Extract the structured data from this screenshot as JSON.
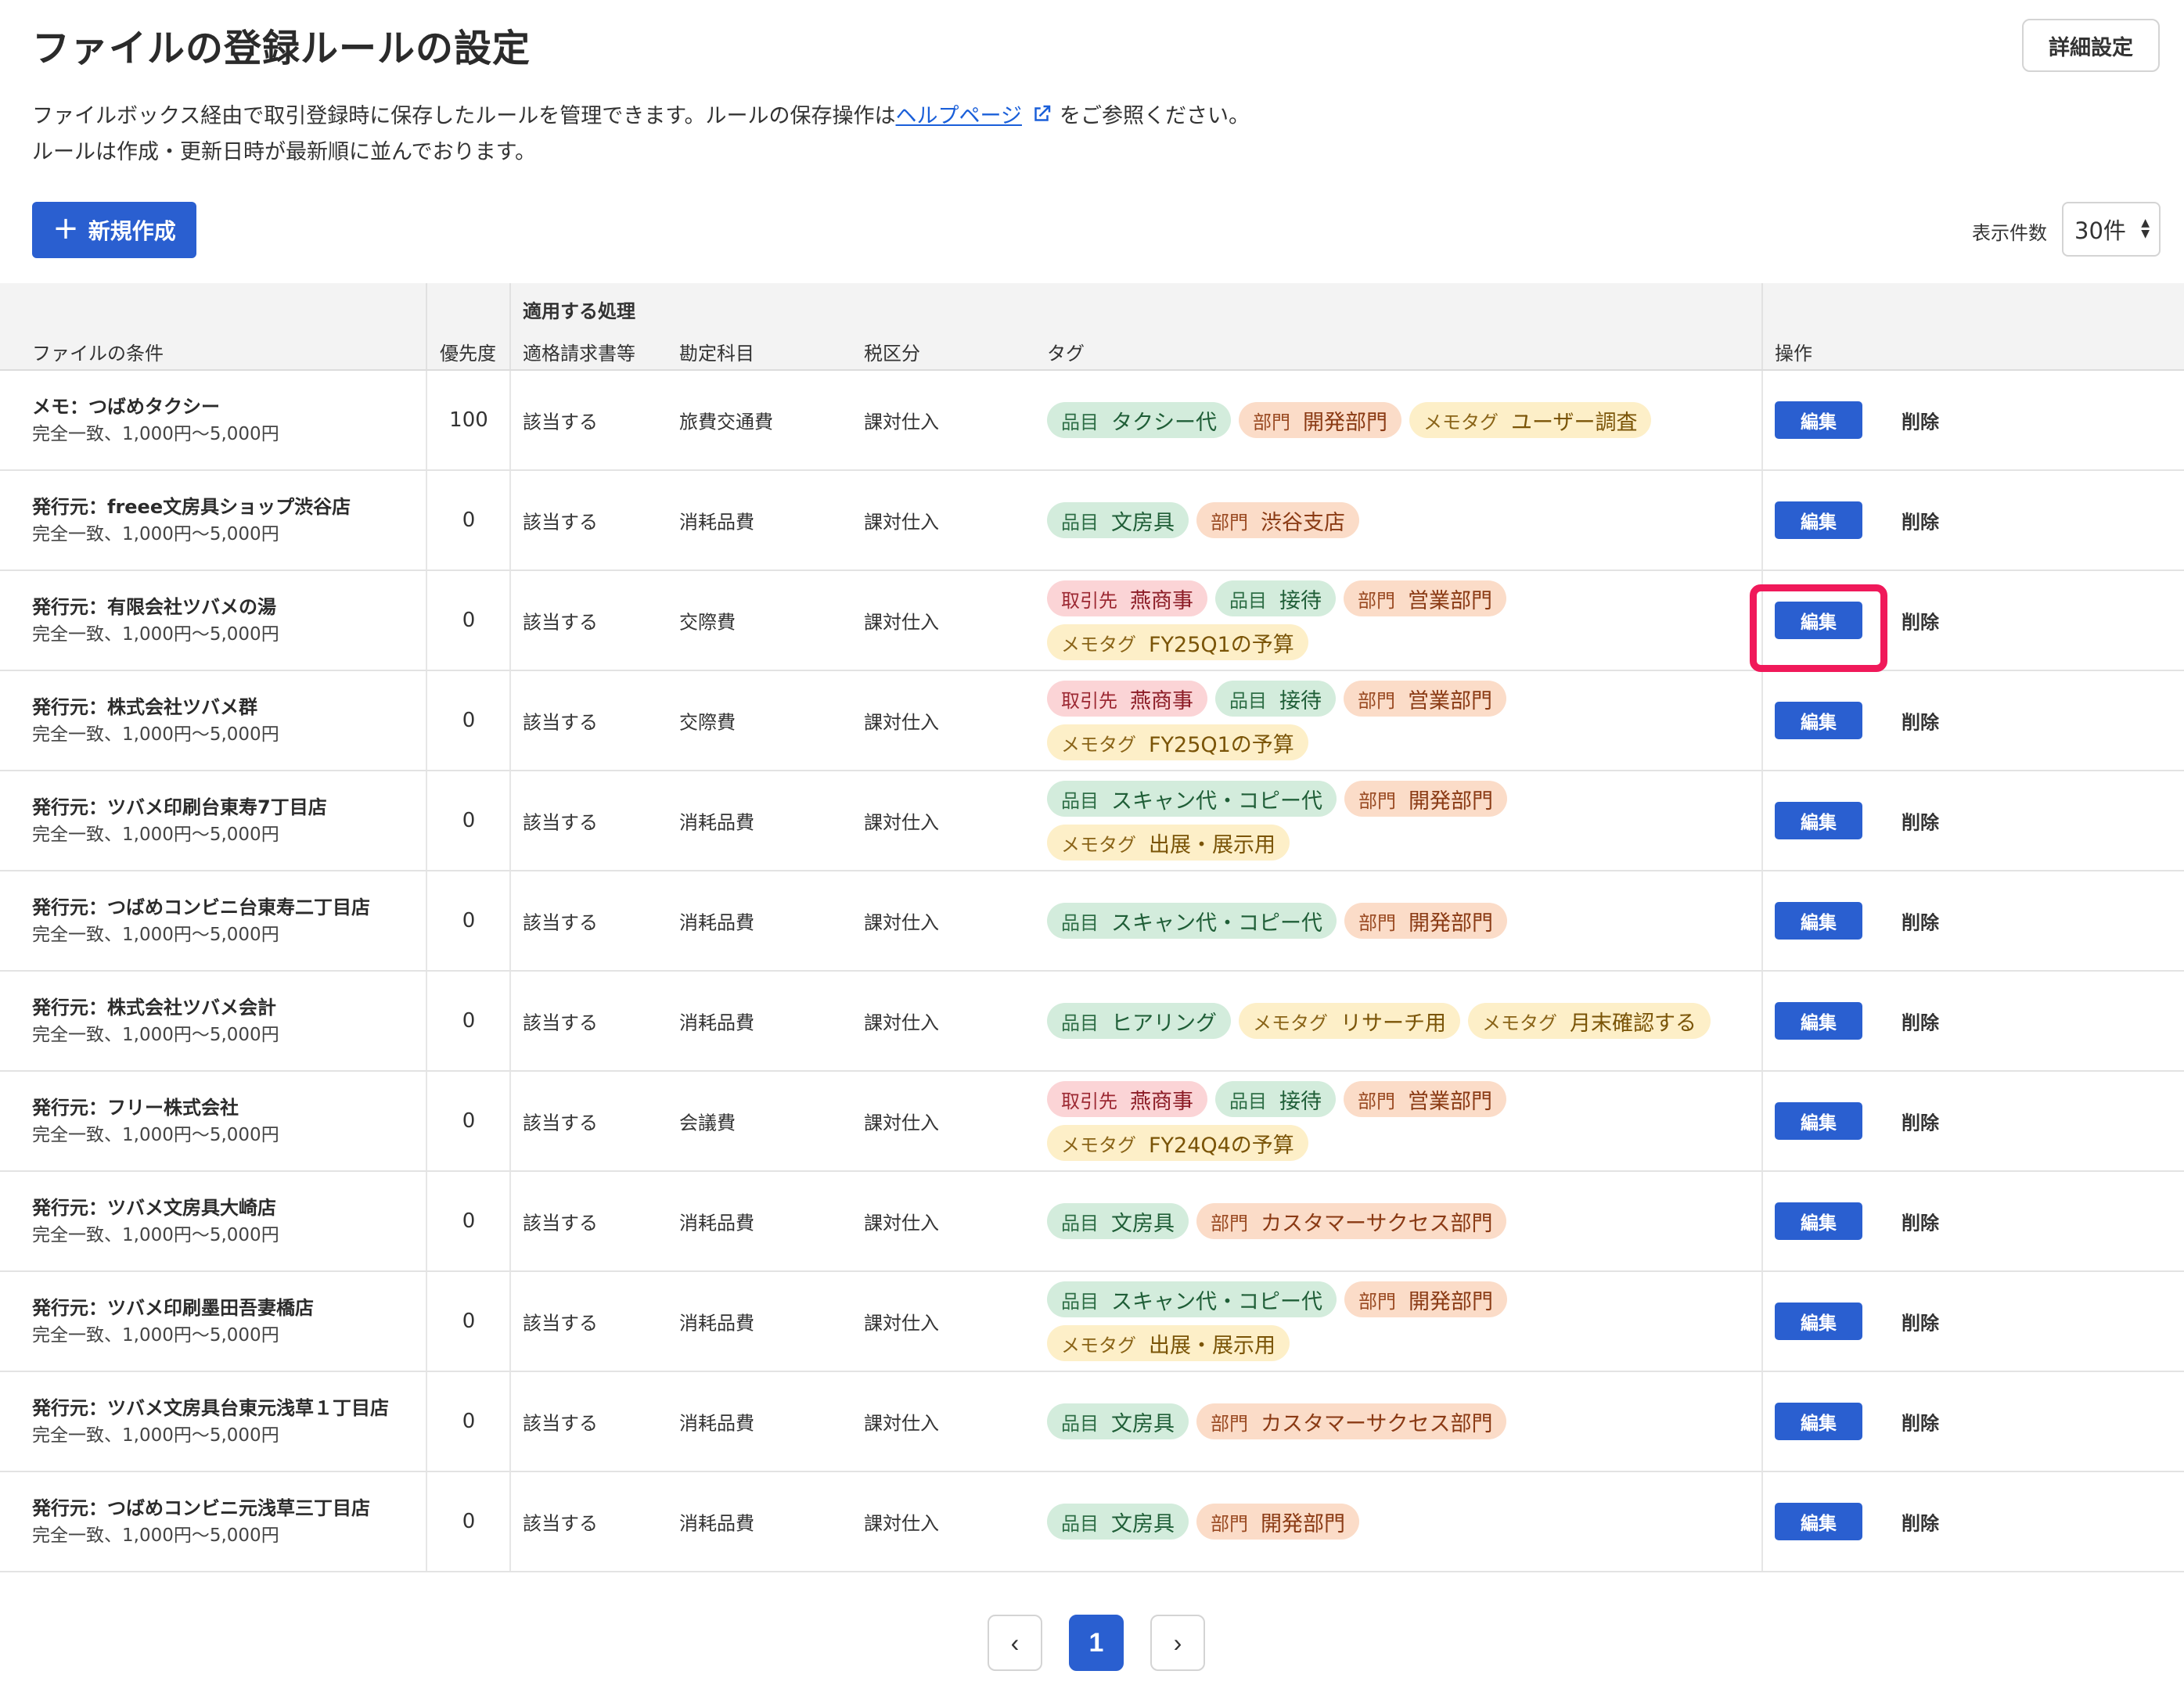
{
  "header": {
    "title": "ファイルの登録ルールの設定",
    "detail_button": "詳細設定",
    "description_line1_prefix": "ファイルボックス経由で取引登録時に保存したルールを管理できます。ルールの保存操作は",
    "description_link": "ヘルプページ",
    "description_line1_suffix": "をご参照ください。",
    "description_line2": "ルールは作成・更新日時が最新順に並んでおります。"
  },
  "toolbar": {
    "create_button": "新規作成",
    "per_page_label": "表示件数",
    "per_page_value": "30件"
  },
  "table": {
    "group_header": "適用する処理",
    "columns": {
      "condition": "ファイルの条件",
      "priority": "優先度",
      "invoice": "適格請求書等",
      "account": "勘定科目",
      "tax": "税区分",
      "tags": "タグ",
      "actions": "操作"
    },
    "edit_label": "編集",
    "delete_label": "削除",
    "rows": [
      {
        "title": "メモ：つばめタクシー",
        "sub": "完全一致、1,000円〜5,000円",
        "priority": "100",
        "invoice": "該当する",
        "account": "旅費交通費",
        "tax": "課対仕入",
        "tags": [
          {
            "kind": "item",
            "k": "品目",
            "v": "タクシー代"
          },
          {
            "kind": "dept",
            "k": "部門",
            "v": "開発部門"
          },
          {
            "kind": "memo",
            "k": "メモタグ",
            "v": "ユーザー調査"
          }
        ]
      },
      {
        "title": "発行元：freee文房具ショップ渋谷店",
        "sub": "完全一致、1,000円〜5,000円",
        "priority": "0",
        "invoice": "該当する",
        "account": "消耗品費",
        "tax": "課対仕入",
        "tags": [
          {
            "kind": "item",
            "k": "品目",
            "v": "文房具"
          },
          {
            "kind": "dept",
            "k": "部門",
            "v": "渋谷支店"
          }
        ]
      },
      {
        "title": "発行元：有限会社ツバメの湯",
        "sub": "完全一致、1,000円〜5,000円",
        "priority": "0",
        "invoice": "該当する",
        "account": "交際費",
        "tax": "課対仕入",
        "tags": [
          {
            "kind": "partner",
            "k": "取引先",
            "v": "燕商事"
          },
          {
            "kind": "item",
            "k": "品目",
            "v": "接待"
          },
          {
            "kind": "dept",
            "k": "部門",
            "v": "営業部門"
          },
          {
            "kind": "memo",
            "k": "メモタグ",
            "v": "FY25Q1の予算"
          }
        ]
      },
      {
        "title": "発行元：株式会社ツバメ群",
        "sub": "完全一致、1,000円〜5,000円",
        "priority": "0",
        "invoice": "該当する",
        "account": "交際費",
        "tax": "課対仕入",
        "tags": [
          {
            "kind": "partner",
            "k": "取引先",
            "v": "燕商事"
          },
          {
            "kind": "item",
            "k": "品目",
            "v": "接待"
          },
          {
            "kind": "dept",
            "k": "部門",
            "v": "営業部門"
          },
          {
            "kind": "memo",
            "k": "メモタグ",
            "v": "FY25Q1の予算"
          }
        ]
      },
      {
        "title": "発行元：ツバメ印刷台東寿7丁目店",
        "sub": "完全一致、1,000円〜5,000円",
        "priority": "0",
        "invoice": "該当する",
        "account": "消耗品費",
        "tax": "課対仕入",
        "tags": [
          {
            "kind": "item",
            "k": "品目",
            "v": "スキャン代・コピー代"
          },
          {
            "kind": "dept",
            "k": "部門",
            "v": "開発部門"
          },
          {
            "kind": "memo",
            "k": "メモタグ",
            "v": "出展・展示用"
          }
        ]
      },
      {
        "title": "発行元：つばめコンビニ台東寿二丁目店",
        "sub": "完全一致、1,000円〜5,000円",
        "priority": "0",
        "invoice": "該当する",
        "account": "消耗品費",
        "tax": "課対仕入",
        "tags": [
          {
            "kind": "item",
            "k": "品目",
            "v": "スキャン代・コピー代"
          },
          {
            "kind": "dept",
            "k": "部門",
            "v": "開発部門"
          }
        ]
      },
      {
        "title": "発行元：株式会社ツバメ会計",
        "sub": "完全一致、1,000円〜5,000円",
        "priority": "0",
        "invoice": "該当する",
        "account": "消耗品費",
        "tax": "課対仕入",
        "tags": [
          {
            "kind": "item",
            "k": "品目",
            "v": "ヒアリング"
          },
          {
            "kind": "memo",
            "k": "メモタグ",
            "v": "リサーチ用"
          },
          {
            "kind": "memo",
            "k": "メモタグ",
            "v": "月末確認する"
          }
        ]
      },
      {
        "title": "発行元：フリー株式会社",
        "sub": "完全一致、1,000円〜5,000円",
        "priority": "0",
        "invoice": "該当する",
        "account": "会議費",
        "tax": "課対仕入",
        "tags": [
          {
            "kind": "partner",
            "k": "取引先",
            "v": "燕商事"
          },
          {
            "kind": "item",
            "k": "品目",
            "v": "接待"
          },
          {
            "kind": "dept",
            "k": "部門",
            "v": "営業部門"
          },
          {
            "kind": "memo",
            "k": "メモタグ",
            "v": "FY24Q4の予算"
          }
        ]
      },
      {
        "title": "発行元：ツバメ文房具大崎店",
        "sub": "完全一致、1,000円〜5,000円",
        "priority": "0",
        "invoice": "該当する",
        "account": "消耗品費",
        "tax": "課対仕入",
        "tags": [
          {
            "kind": "item",
            "k": "品目",
            "v": "文房具"
          },
          {
            "kind": "dept",
            "k": "部門",
            "v": "カスタマーサクセス部門"
          }
        ]
      },
      {
        "title": "発行元：ツバメ印刷墨田吾妻橋店",
        "sub": "完全一致、1,000円〜5,000円",
        "priority": "0",
        "invoice": "該当する",
        "account": "消耗品費",
        "tax": "課対仕入",
        "tags": [
          {
            "kind": "item",
            "k": "品目",
            "v": "スキャン代・コピー代"
          },
          {
            "kind": "dept",
            "k": "部門",
            "v": "開発部門"
          },
          {
            "kind": "memo",
            "k": "メモタグ",
            "v": "出展・展示用"
          }
        ]
      },
      {
        "title": "発行元：ツバメ文房具台東元浅草１丁目店",
        "sub": "完全一致、1,000円〜5,000円",
        "priority": "0",
        "invoice": "該当する",
        "account": "消耗品費",
        "tax": "課対仕入",
        "tags": [
          {
            "kind": "item",
            "k": "品目",
            "v": "文房具"
          },
          {
            "kind": "dept",
            "k": "部門",
            "v": "カスタマーサクセス部門"
          }
        ]
      },
      {
        "title": "発行元：つばめコンビニ元浅草三丁目店",
        "sub": "完全一致、1,000円〜5,000円",
        "priority": "0",
        "invoice": "該当する",
        "account": "消耗品費",
        "tax": "課対仕入",
        "tags": [
          {
            "kind": "item",
            "k": "品目",
            "v": "文房具"
          },
          {
            "kind": "dept",
            "k": "部門",
            "v": "開発部門"
          }
        ]
      }
    ]
  },
  "pagination": {
    "prev": "‹",
    "current": "1",
    "next": "›"
  }
}
